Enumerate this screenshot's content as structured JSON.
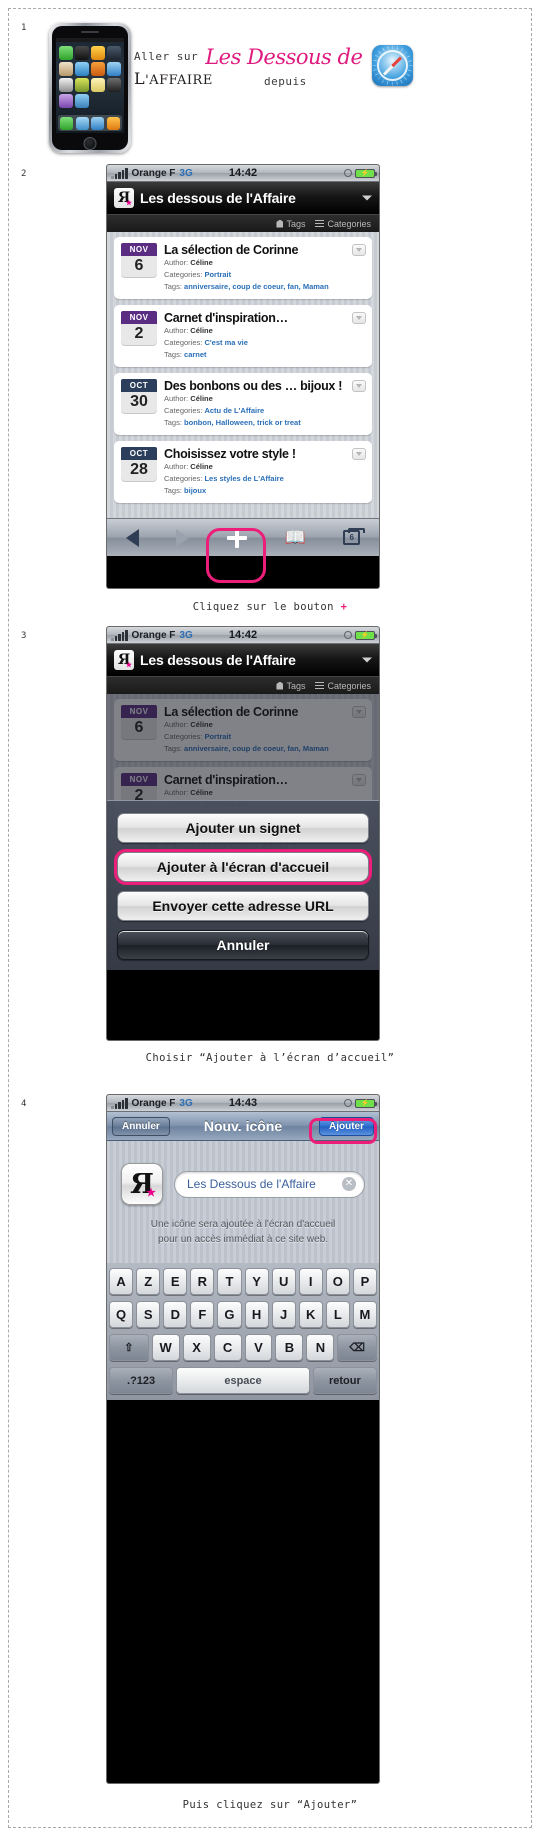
{
  "steps": [
    {
      "num": "1"
    },
    {
      "num": "2"
    },
    {
      "num": "3"
    },
    {
      "num": "4"
    }
  ],
  "step1": {
    "lead": "Aller sur",
    "logo_script": "Les Dessous de",
    "logo_serif_caps": "L",
    "logo_serif_rest": "'A",
    "logo_serif_tail": "FFAIRE",
    "depuis": "depuis",
    "safari_icon": "safari-compass-icon"
  },
  "status": {
    "carrier": "Orange F",
    "network": "3G",
    "time_step2": "14:42",
    "time_step3": "14:42",
    "time_step4": "14:43",
    "lock_icon": "lock-rotation-icon",
    "battery_icon": "battery-charging-icon"
  },
  "site": {
    "logo_glyph": "Я",
    "logo_star": "★",
    "title": "Les dessous de l'Affaire",
    "caret_icon": "chevron-down-icon",
    "tags_label": "Tags",
    "tags_icon": "tag-icon",
    "categories_label": "Categories",
    "categories_icon": "list-icon"
  },
  "posts": [
    {
      "month": "NOV",
      "day": "6",
      "month_color": "#5b2d82",
      "title": "La sélection de Corinne",
      "author_label": "Author:",
      "author": "Céline",
      "categories_label": "Categories:",
      "categories": "Portrait",
      "tags_label": "Tags:",
      "tags": "anniversaire, coup de coeur, fan, Maman"
    },
    {
      "month": "NOV",
      "day": "2",
      "month_color": "#5b2d82",
      "title": "Carnet d'inspiration…",
      "author_label": "Author:",
      "author": "Céline",
      "categories_label": "Categories:",
      "categories": "C'est ma vie",
      "tags_label": "Tags:",
      "tags": "carnet"
    },
    {
      "month": "OCT",
      "day": "30",
      "month_color": "#2b3f5c",
      "title": "Des bonbons ou des … bijoux !",
      "author_label": "Author:",
      "author": "Céline",
      "categories_label": "Categories:",
      "categories": "Actu de L'Affaire",
      "tags_label": "Tags:",
      "tags": "bonbon, Halloween, trick or treat"
    },
    {
      "month": "OCT",
      "day": "28",
      "month_color": "#2b3f5c",
      "title": "Choisissez votre style !",
      "author_label": "Author:",
      "author": "Céline",
      "categories_label": "Categories:",
      "categories": "Les styles de L'Affaire",
      "tags_label": "Tags:",
      "tags": "bijoux"
    }
  ],
  "toolbar": {
    "back_icon": "back-arrow-icon",
    "forward_icon": "forward-arrow-icon",
    "add_icon": "plus-icon",
    "bookmarks_icon": "book-icon",
    "tabs_icon": "tabs-icon",
    "tabs_count": "6"
  },
  "step2": {
    "caption_before": "Cliquez sur le bouton",
    "caption_plus": "+"
  },
  "sheet": {
    "bookmark": "Ajouter un signet",
    "home_screen": "Ajouter à l'écran d'accueil",
    "mail_url": "Envoyer cette adresse URL",
    "cancel": "Annuler"
  },
  "step3": {
    "caption": "Choisir “Ajouter à l’écran d’accueil”"
  },
  "step4": {
    "nav_cancel": "Annuler",
    "nav_title": "Nouv. icône",
    "nav_add": "Ajouter",
    "icon_glyph": "Я",
    "icon_star": "★",
    "field_value": "Les Dessous de l'Affaire",
    "clear_icon": "clear-field-icon",
    "hint_line1": "Une icône sera ajoutée à l'écran d'accueil",
    "hint_line2": "pour un accès immédiat à ce site web.",
    "caption": "Puis cliquez sur “Ajouter”"
  },
  "keyboard": {
    "row1": [
      "A",
      "Z",
      "E",
      "R",
      "T",
      "Y",
      "U",
      "I",
      "O",
      "P"
    ],
    "row2": [
      "Q",
      "S",
      "D",
      "F",
      "G",
      "H",
      "J",
      "K",
      "L",
      "M"
    ],
    "row3_shift": "⇧",
    "row3": [
      "W",
      "X",
      "C",
      "V",
      "B",
      "N"
    ],
    "row3_back": "⌫",
    "numbers": ".?123",
    "space": "espace",
    "return": "retour"
  }
}
